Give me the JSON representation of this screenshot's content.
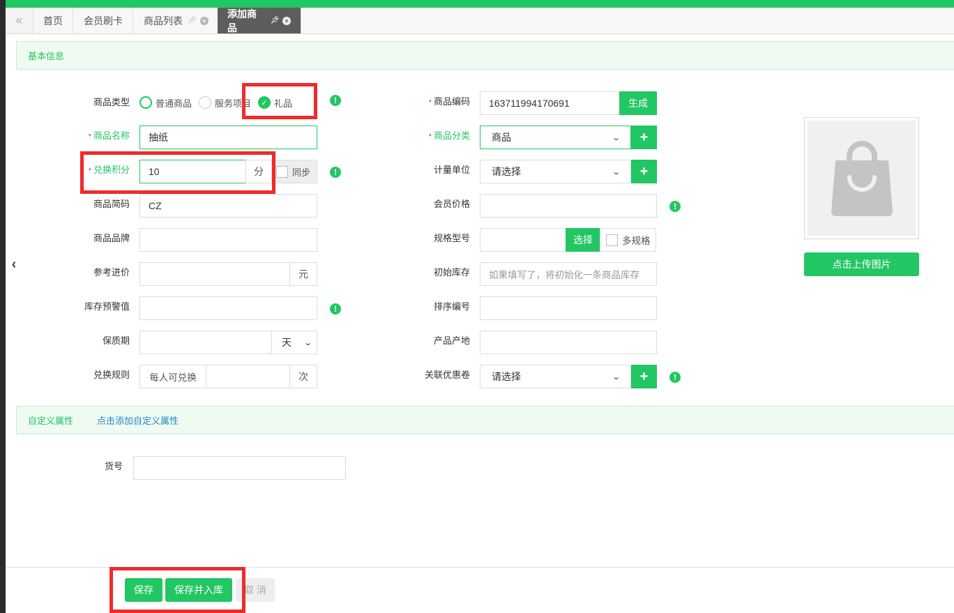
{
  "tabs": {
    "collapse_icon": "double-chevron-left-icon",
    "items": [
      {
        "label": "首页"
      },
      {
        "label": "会员刷卡"
      },
      {
        "label": "商品列表"
      },
      {
        "label": "添加商品"
      }
    ]
  },
  "basic_section": {
    "title": "基本信息"
  },
  "form": {
    "product_type": {
      "label": "商品类型",
      "options": [
        "普通商品",
        "服务项目",
        "礼品"
      ],
      "selected": "礼品"
    },
    "product_name": {
      "label": "商品名称",
      "value": "抽纸"
    },
    "points": {
      "label": "兑换积分",
      "value": "10",
      "unit": "分",
      "sync_label": "同步"
    },
    "short_code": {
      "label": "商品简码",
      "value": "CZ"
    },
    "brand": {
      "label": "商品品牌",
      "value": ""
    },
    "purchase_price": {
      "label": "参考进价",
      "value": "",
      "unit": "元"
    },
    "stock_warning": {
      "label": "库存预警值",
      "value": ""
    },
    "shelf_life": {
      "label": "保质期",
      "value": "",
      "unit": "天"
    },
    "exchange_rule": {
      "label": "兑换规则",
      "prefix": "每人可兑换",
      "value": "",
      "unit": "次"
    },
    "product_code": {
      "label": "商品编码",
      "value": "163711994170691",
      "button": "生成"
    },
    "category": {
      "label": "商品分类",
      "value": "商品"
    },
    "unit": {
      "label": "计量单位",
      "value": "请选择"
    },
    "member_price": {
      "label": "会员价格",
      "value": ""
    },
    "spec": {
      "label": "规格型号",
      "value": "",
      "button": "选择",
      "multi_label": "多规格"
    },
    "initial_stock": {
      "label": "初始库存",
      "placeholder": "如果填写了，将初始化一条商品库存"
    },
    "sort_no": {
      "label": "排序编号",
      "value": ""
    },
    "origin": {
      "label": "产品产地",
      "value": ""
    },
    "coupon": {
      "label": "关联优惠卷",
      "value": "请选择"
    }
  },
  "upload": {
    "button": "点击上传图片",
    "icon": "shopping-bag-icon"
  },
  "custom_section": {
    "title": "自定义属性",
    "add_link": "点击添加自定义属性"
  },
  "custom": {
    "item_no": {
      "label": "货号",
      "value": ""
    }
  },
  "footer": {
    "save": "保存",
    "save_stock": "保存并入库",
    "cancel": "取 消"
  },
  "colors": {
    "accent": "#22c663",
    "highlight": "#ef2b2b",
    "link": "#1f8acb"
  }
}
